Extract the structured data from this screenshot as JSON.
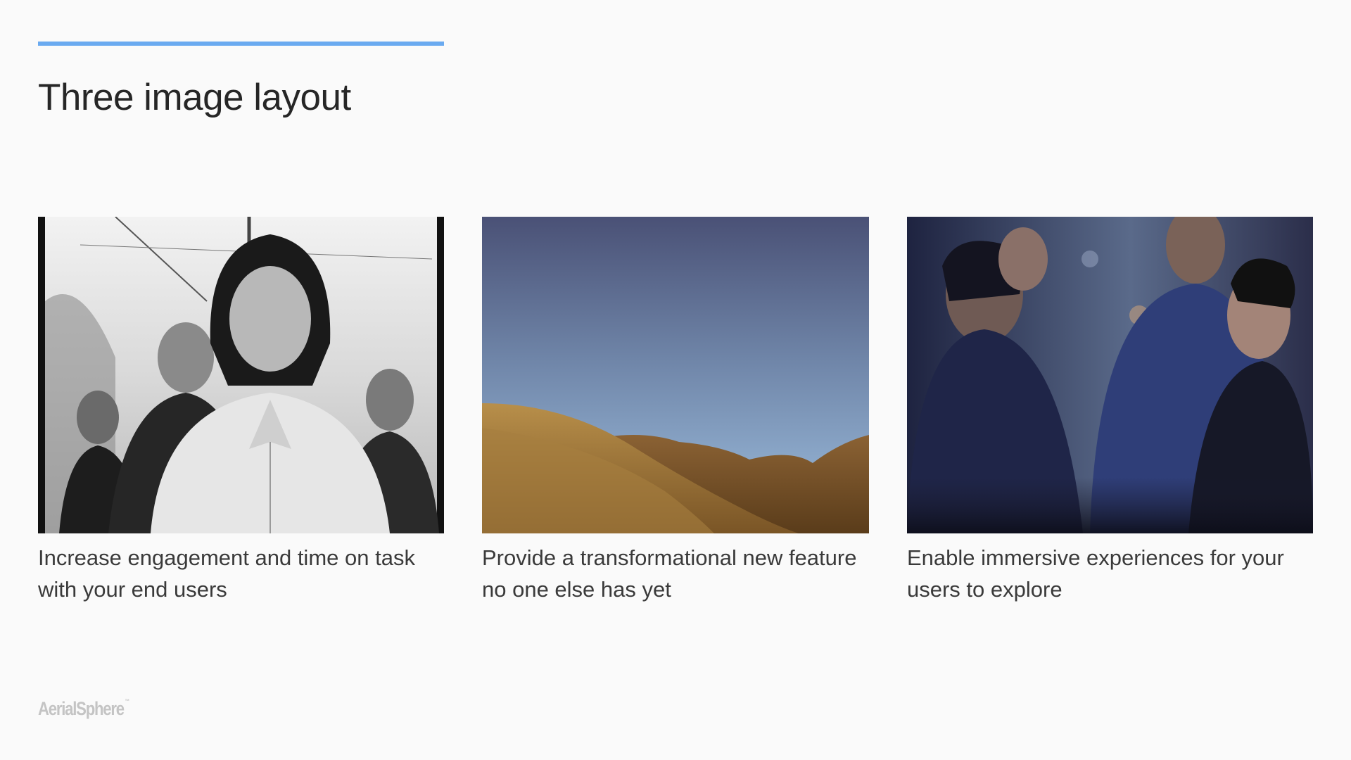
{
  "slide": {
    "title": "Three image layout",
    "accent_color": "#6aaaf0",
    "cards": [
      {
        "image": "black-and-white band portrait",
        "caption": "Increase engagement and time on task with your end users"
      },
      {
        "image": "golden hills under blue sky",
        "caption": "Provide a transformational new feature no one else has yet"
      },
      {
        "image": "band portrait in blue tones",
        "caption": "Enable immersive experiences for your users to explore"
      }
    ],
    "logo": {
      "text": "AerialSphere",
      "mark": "™"
    }
  }
}
